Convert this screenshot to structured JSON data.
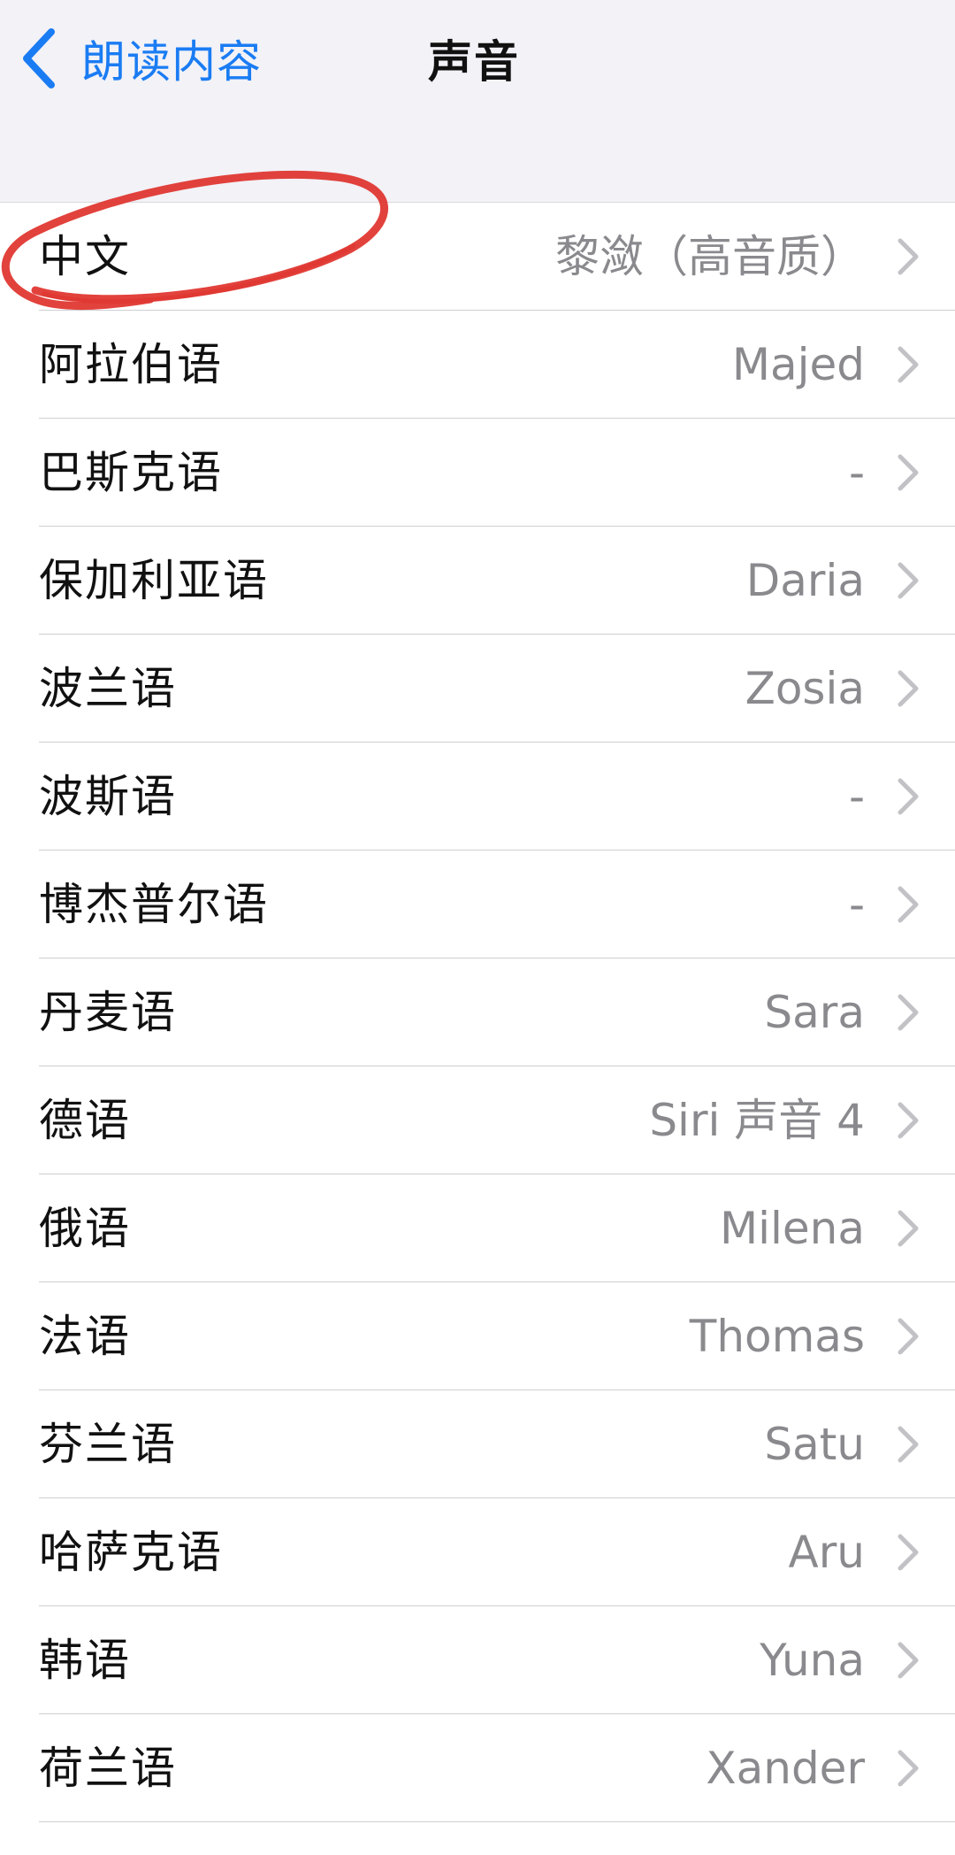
{
  "navbar": {
    "back_label": "朗读内容",
    "title": "声音"
  },
  "languages": [
    {
      "label": "中文",
      "value": "黎潋（高音质）"
    },
    {
      "label": "阿拉伯语",
      "value": "Majed"
    },
    {
      "label": "巴斯克语",
      "value": "-"
    },
    {
      "label": "保加利亚语",
      "value": "Daria"
    },
    {
      "label": "波兰语",
      "value": "Zosia"
    },
    {
      "label": "波斯语",
      "value": "-"
    },
    {
      "label": "博杰普尔语",
      "value": "-"
    },
    {
      "label": "丹麦语",
      "value": "Sara"
    },
    {
      "label": "德语",
      "value": "Siri 声音 4"
    },
    {
      "label": "俄语",
      "value": "Milena"
    },
    {
      "label": "法语",
      "value": "Thomas"
    },
    {
      "label": "芬兰语",
      "value": "Satu"
    },
    {
      "label": "哈萨克语",
      "value": "Aru"
    },
    {
      "label": "韩语",
      "value": "Yuna"
    },
    {
      "label": "荷兰语",
      "value": "Xander"
    }
  ],
  "colors": {
    "accent": "#1a7cf3",
    "annotation": "#e0322b"
  },
  "icons": {
    "back": "chevron-left-icon",
    "row": "chevron-right-icon"
  }
}
